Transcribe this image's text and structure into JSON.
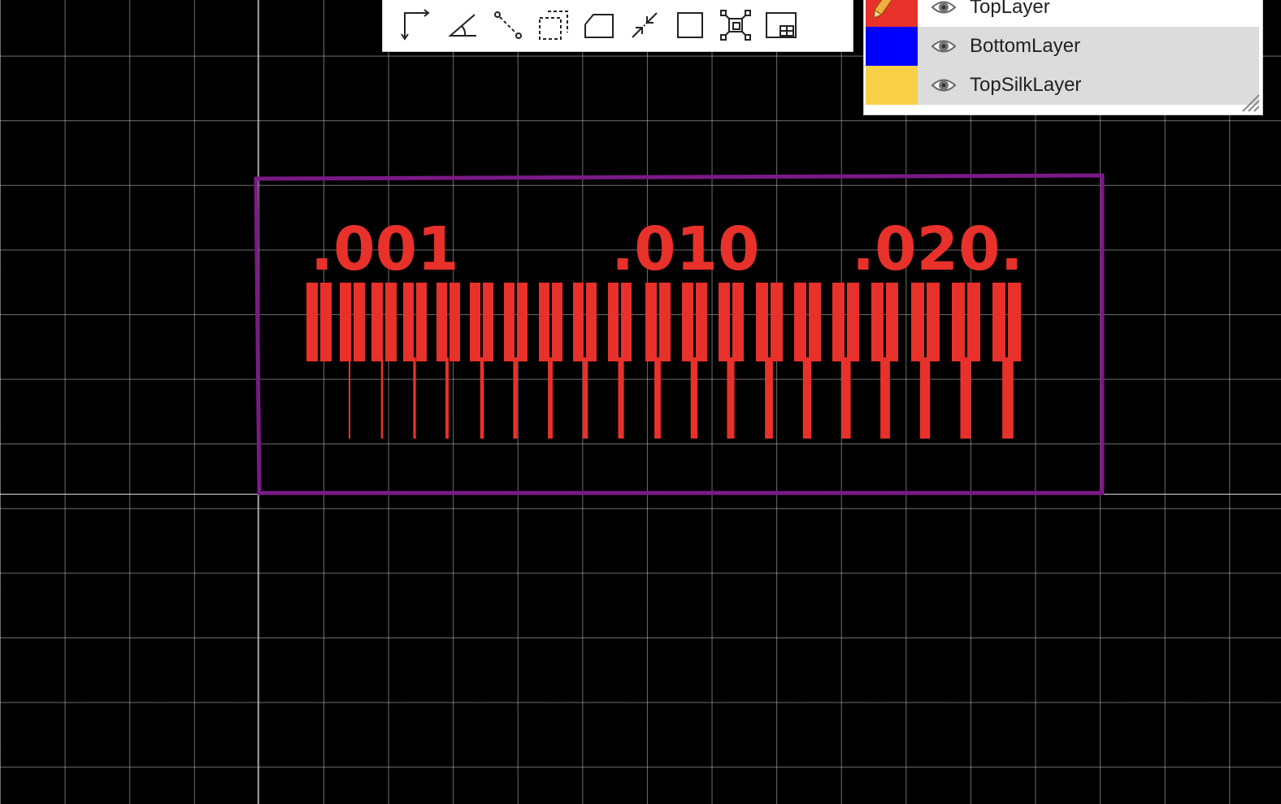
{
  "toolbar": {
    "tools": [
      {
        "name": "route-track-icon"
      },
      {
        "name": "angle-dimension-icon"
      },
      {
        "name": "dashed-line-icon"
      },
      {
        "name": "dashed-rect-icon"
      },
      {
        "name": "polygon-icon"
      },
      {
        "name": "shrink-arrows-icon"
      },
      {
        "name": "rectangle-icon"
      },
      {
        "name": "fit-view-icon"
      },
      {
        "name": "table-icon"
      }
    ]
  },
  "layers": [
    {
      "name": "TopLayer",
      "color": "#e8312a",
      "active": true,
      "selected": false
    },
    {
      "name": "BottomLayer",
      "color": "#0000ff",
      "active": false,
      "selected": true
    },
    {
      "name": "TopSilkLayer",
      "color": "#f8d048",
      "active": false,
      "selected": true
    }
  ],
  "pcb": {
    "board_outline_color": "#7a1a86",
    "copper_color": "#e8312a",
    "labels": [
      ".001",
      ".010",
      ".020."
    ]
  }
}
